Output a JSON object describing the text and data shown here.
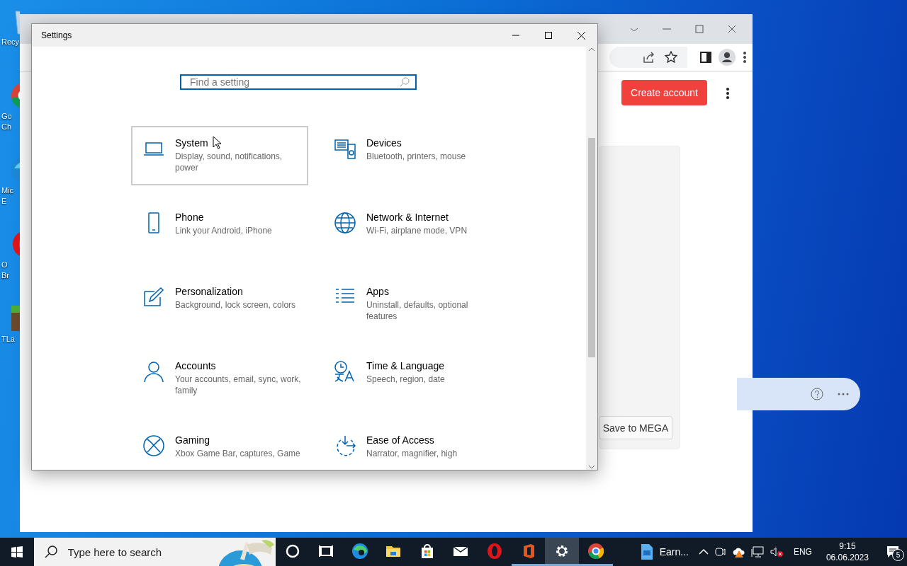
{
  "desktop_icons": [
    {
      "lines": [
        "Recy"
      ]
    },
    {
      "lines": [
        "Go",
        "Ch"
      ]
    },
    {
      "lines": [
        "Mic",
        "E"
      ]
    },
    {
      "lines": [
        "O",
        "Br"
      ]
    },
    {
      "lines": [
        "TLa"
      ]
    }
  ],
  "browser": {
    "create_button": "Create account",
    "save_button": "Save to MEGA"
  },
  "settings": {
    "title": "Settings",
    "search": {
      "placeholder": "Find a setting"
    },
    "categories": [
      {
        "name": "System",
        "description": "Display, sound, notifications, power",
        "hovered": true
      },
      {
        "name": "Devices",
        "description": "Bluetooth, printers, mouse",
        "hovered": false
      },
      {
        "name": "Phone",
        "description": "Link your Android, iPhone",
        "hovered": false
      },
      {
        "name": "Network & Internet",
        "description": "Wi-Fi, airplane mode, VPN",
        "hovered": false
      },
      {
        "name": "Personalization",
        "description": "Background, lock screen, colors",
        "hovered": false
      },
      {
        "name": "Apps",
        "description": "Uninstall, defaults, optional features",
        "hovered": false
      },
      {
        "name": "Accounts",
        "description": "Your accounts, email, sync, work, family",
        "hovered": false
      },
      {
        "name": "Time & Language",
        "description": "Speech, region, date",
        "hovered": false
      },
      {
        "name": "Gaming",
        "description": "Xbox Game Bar, captures, Game",
        "hovered": false
      },
      {
        "name": "Ease of Access",
        "description": "Narrator, magnifier, high",
        "hovered": false
      }
    ]
  },
  "taskbar": {
    "search": {
      "placeholder": "Type here to search"
    },
    "apps": [
      {
        "running": false,
        "selected": false
      },
      {
        "running": false,
        "selected": false
      },
      {
        "running": false,
        "selected": false
      },
      {
        "running": false,
        "selected": false
      },
      {
        "running": false,
        "selected": false
      },
      {
        "running": false,
        "selected": false
      },
      {
        "running": false,
        "selected": false
      },
      {
        "running": true,
        "selected": false
      },
      {
        "running": true,
        "selected": true
      },
      {
        "running": true,
        "selected": false
      }
    ],
    "window_button": {
      "label": "Earn..."
    },
    "language": "ENG",
    "time": "9:15",
    "date": "06.06.2023",
    "notification_count": "5"
  }
}
